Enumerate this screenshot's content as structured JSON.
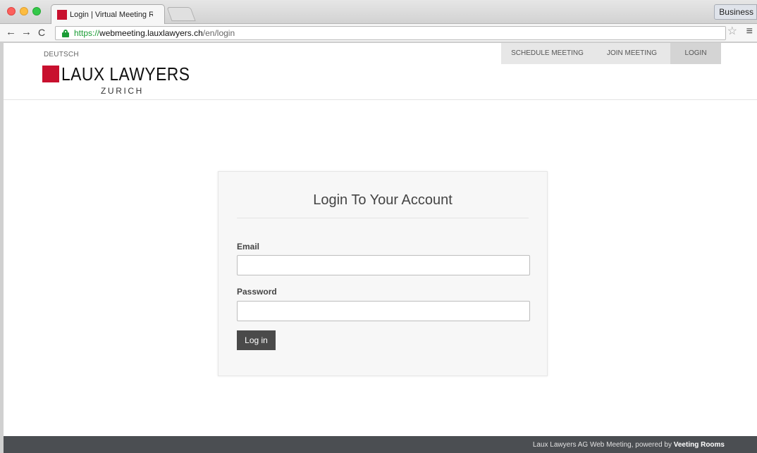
{
  "browser": {
    "tab": {
      "title": "Login | Virtual Meeting Roo",
      "close": "×"
    },
    "profile": "Business",
    "address": {
      "scheme": "https://",
      "host": "webmeeting.lauxlawyers.ch",
      "path": "/en/login"
    },
    "icons": {
      "back": "←",
      "forward": "→",
      "reload": "C",
      "star": "☆",
      "menu": "≡"
    }
  },
  "header": {
    "language_link": "DEUTSCH",
    "logo": {
      "name": "LAUX LAWYERS",
      "city": "ZURICH",
      "brand_color": "#c8102e"
    },
    "nav": {
      "schedule": "SCHEDULE MEETING",
      "join": "JOIN MEETING",
      "login": "LOGIN"
    }
  },
  "login_form": {
    "title": "Login To Your Account",
    "email_label": "Email",
    "email_value": "",
    "password_label": "Password",
    "password_value": "",
    "submit_label": "Log in"
  },
  "footer": {
    "text": "Laux Lawyers AG Web Meeting, powered by ",
    "link": "Veeting Rooms"
  }
}
